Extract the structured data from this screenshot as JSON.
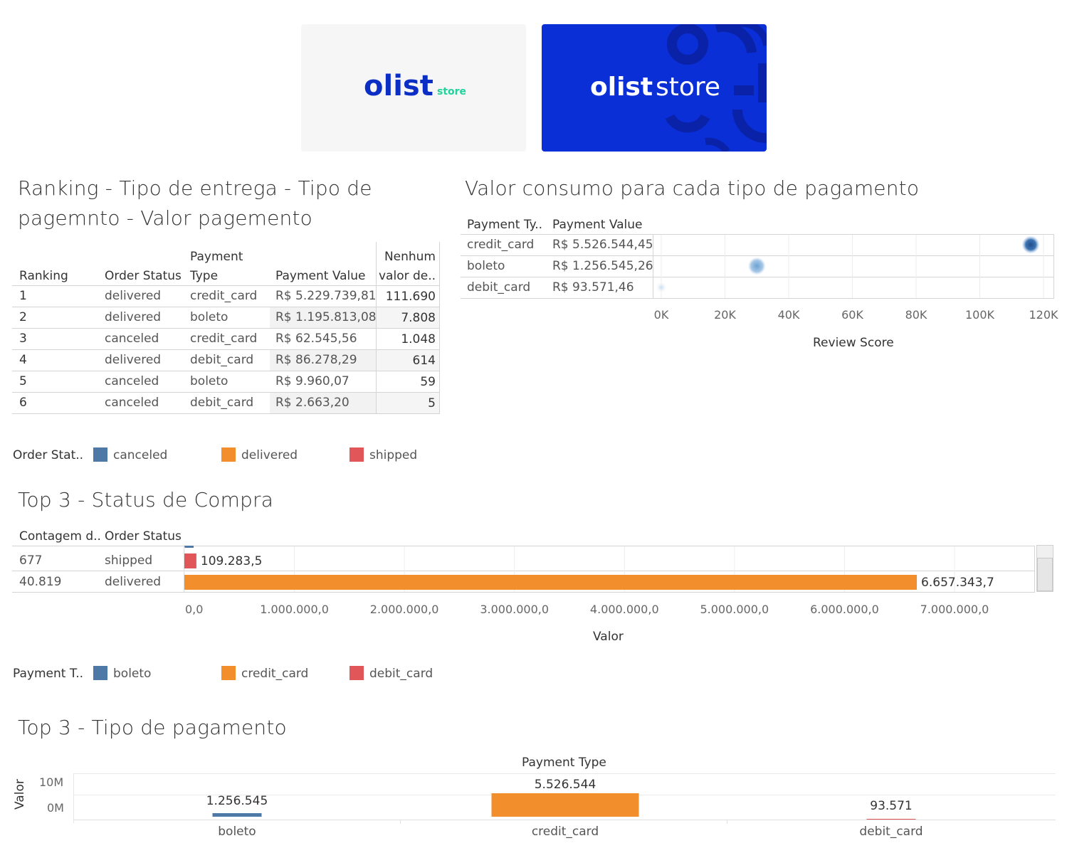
{
  "logos": {
    "light": {
      "word": "olist",
      "tag": "store"
    },
    "dark": {
      "word": "olist",
      "tag": "store"
    }
  },
  "ranking": {
    "title_line1": "Ranking  - Tipo de entrega - Tipo de",
    "title_line2": "pagemnto - Valor pagemento",
    "headers": {
      "ranking": "Ranking",
      "order_status": "Order Status",
      "payment_type_1": "Payment",
      "payment_type_2": "Type",
      "payment_value": "Payment Value",
      "count_1": "Nenhum",
      "count_2": "valor de.."
    },
    "rows": [
      {
        "rank": "1",
        "status": "delivered",
        "type": "credit_card",
        "value": "R$ 5.229.739,81",
        "count": "111.690"
      },
      {
        "rank": "2",
        "status": "delivered",
        "type": "boleto",
        "value": "R$ 1.195.813,08",
        "count": "7.808"
      },
      {
        "rank": "3",
        "status": "canceled",
        "type": "credit_card",
        "value": "R$ 62.545,56",
        "count": "1.048"
      },
      {
        "rank": "4",
        "status": "delivered",
        "type": "debit_card",
        "value": "R$ 86.278,29",
        "count": "614"
      },
      {
        "rank": "5",
        "status": "canceled",
        "type": "boleto",
        "value": "R$ 9.960,07",
        "count": "59"
      },
      {
        "rank": "6",
        "status": "canceled",
        "type": "debit_card",
        "value": "R$ 2.663,20",
        "count": "5"
      }
    ]
  },
  "legend_status": {
    "label": "Order Stat..",
    "items": [
      {
        "name": "canceled",
        "color": "#4e79a7"
      },
      {
        "name": "delivered",
        "color": "#f28e2b"
      },
      {
        "name": "shipped",
        "color": "#e15759"
      }
    ]
  },
  "consumo": {
    "title": "Valor consumo para cada tipo de pagamento",
    "headers": {
      "payment_type": "Payment Ty..",
      "payment_value": "Payment Value"
    },
    "rows": [
      {
        "type": "credit_card",
        "value": "R$ 5.526.544,45"
      },
      {
        "type": "boleto",
        "value": "R$ 1.256.545,26"
      },
      {
        "type": "debit_card",
        "value": "R$ 93.571,46"
      }
    ],
    "xlabel": "Review Score",
    "ticks": [
      "0K",
      "20K",
      "40K",
      "60K",
      "80K",
      "100K",
      "120K"
    ]
  },
  "top3_status": {
    "title": "Top 3 - Status de Compra",
    "headers": {
      "count": "Contagem d..",
      "order_status": "Order Status"
    },
    "rows": [
      {
        "count": "677",
        "status": "shipped",
        "value_label": "109.283,5"
      },
      {
        "count": "40.819",
        "status": "delivered",
        "value_label": "6.657.343,7"
      }
    ],
    "xlabel": "Valor",
    "ticks": [
      "0,0",
      "1.000.000,0",
      "2.000.000,0",
      "3.000.000,0",
      "4.000.000,0",
      "5.000.000,0",
      "6.000.000,0",
      "7.000.000,0"
    ]
  },
  "legend_payment": {
    "label": "Payment T..",
    "items": [
      {
        "name": "boleto",
        "color": "#4e79a7"
      },
      {
        "name": "credit_card",
        "color": "#f28e2b"
      },
      {
        "name": "debit_card",
        "color": "#e15759"
      }
    ]
  },
  "top3_payment": {
    "title": "Top 3 - Tipo de pagamento",
    "column_header": "Payment Type",
    "ylabel": "Valor",
    "yticks": [
      "10M",
      "0M"
    ]
  },
  "chart_data": [
    {
      "type": "scatter",
      "title": "Valor consumo para cada tipo de pagamento",
      "xlabel": "Review Score",
      "xlim": [
        0,
        120000
      ],
      "categories": [
        "credit_card",
        "boleto",
        "debit_card"
      ],
      "x": [
        116000,
        30000,
        0
      ]
    },
    {
      "type": "bar",
      "title": "Top 3 - Status de Compra",
      "xlabel": "Valor",
      "xlim": [
        0,
        7000000
      ],
      "categories": [
        "shipped",
        "delivered"
      ],
      "values": [
        109283.5,
        6657343.7
      ],
      "colors": [
        "#e15759",
        "#f28e2b"
      ]
    },
    {
      "type": "bar",
      "title": "Top 3 - Tipo de pagamento",
      "xlabel": "Payment Type",
      "ylabel": "Valor",
      "categories": [
        "boleto",
        "credit_card",
        "debit_card"
      ],
      "values": [
        1256545,
        5526544,
        93571
      ],
      "labels": [
        "1.256.545",
        "5.526.544",
        "93.571"
      ],
      "colors": [
        "#4e79a7",
        "#f28e2b",
        "#e15759"
      ]
    }
  ]
}
